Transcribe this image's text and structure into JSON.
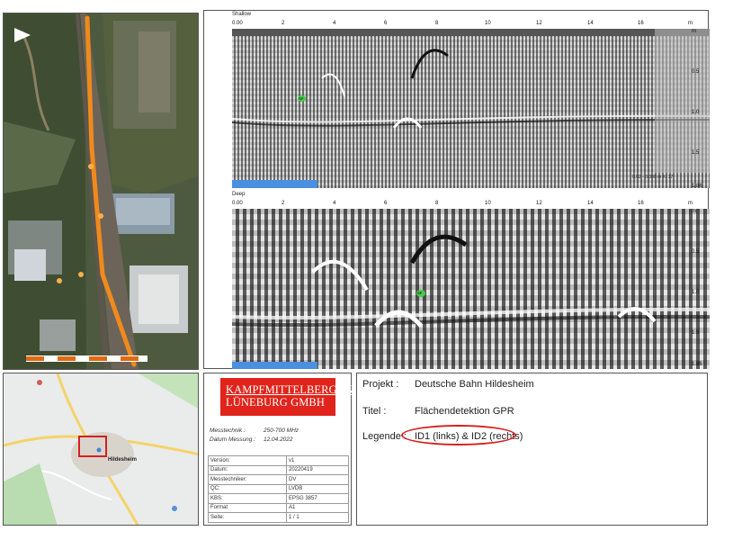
{
  "gpr": {
    "shallow_label": "Shallow",
    "deep_label": "Deep",
    "x_ticks": [
      "0.00",
      "2",
      "4",
      "6",
      "8",
      "10",
      "12",
      "14",
      "16"
    ],
    "x_unit": "m",
    "y_unit": "m",
    "y_ticks": [
      "0.5",
      "1.0",
      "1.5"
    ],
    "y_bottom": "1.86",
    "marker_label": "SP",
    "shallow_readout": "0.02 - 0.000 m X: 17"
  },
  "company": {
    "logo_line1": "KAMPFMITTELBERGUNG",
    "logo_line2": "LÜNEBURG GMBH",
    "messtechnik_label": "Messtechnik :",
    "messtechnik_value": "250-700 MHz",
    "datum_label": "Datum Messung :",
    "datum_value": "12.04.2022",
    "table": [
      [
        "Version:",
        "v1"
      ],
      [
        "Datum:",
        "20220419"
      ],
      [
        "Messtechniker:",
        "DV"
      ],
      [
        "QC:",
        "LVDB"
      ],
      [
        "KBS:",
        "EPSG 3857"
      ],
      [
        "Format",
        "A1"
      ],
      [
        "Seite:",
        "1 / 1"
      ]
    ]
  },
  "project": {
    "projekt_label": "Projekt :",
    "projekt_value": "Deutsche Bahn Hildesheim",
    "titel_label": "Titel :",
    "titel_value": "Flächendetektion GPR",
    "legende_label": "Legende :",
    "legende_value": "ID1 (links) & ID2 (rechts)"
  },
  "map": {
    "city_label": "Hildesheim"
  },
  "colors": {
    "brand_red": "#e0241b",
    "track_orange": "#f08a1c",
    "scan_blue": "#4a8fe0",
    "legend_circle": "#d42020"
  }
}
